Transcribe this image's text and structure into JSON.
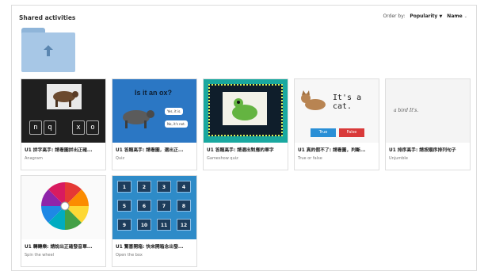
{
  "header": {
    "title": "Shared activities",
    "order_label": "Order by:",
    "order_primary": "Popularity",
    "order_secondary": "Name"
  },
  "folder": {
    "icon": "folder-up-icon"
  },
  "cards": [
    {
      "title": "U1 拼字高手: 請看圖拼出正確...",
      "type": "Anagram",
      "letters": [
        "n",
        "q",
        "x",
        "o"
      ]
    },
    {
      "title": "U1 答題高手: 請看圖，選出正...",
      "type": "Quiz",
      "question": "Is it an ox?",
      "answers": [
        "Yes, it is.",
        "No, it's not."
      ]
    },
    {
      "title": "U1 答題高手: 請選出對應的單字",
      "type": "Gameshow quiz"
    },
    {
      "title": "U1 真的假不了: 請看圖，判斷...",
      "type": "True or false",
      "statement": "It's a cat.",
      "true_label": "True",
      "false_label": "False"
    },
    {
      "title": "U1 排序高手: 請按順序排列句子",
      "type": "Unjumble",
      "phrase": "a bird It's."
    },
    {
      "title": "U1 轉轉樂: 請說出正確發音單...",
      "type": "Spin the wheel"
    },
    {
      "title": "U1 驚喜開箱: 快來開箱念出發...",
      "type": "Open the box",
      "boxes": [
        "1",
        "2",
        "3",
        "4",
        "5",
        "6",
        "7",
        "8",
        "9",
        "10",
        "11",
        "12"
      ]
    }
  ],
  "colors": {
    "folder": "#a7c7e6",
    "quiz_bg": "#2b77c4",
    "gameshow_bg": "#19a8a0",
    "true_btn": "#2a8fd6",
    "false_btn": "#d93a3a",
    "box_bg": "#2e8bc8"
  }
}
